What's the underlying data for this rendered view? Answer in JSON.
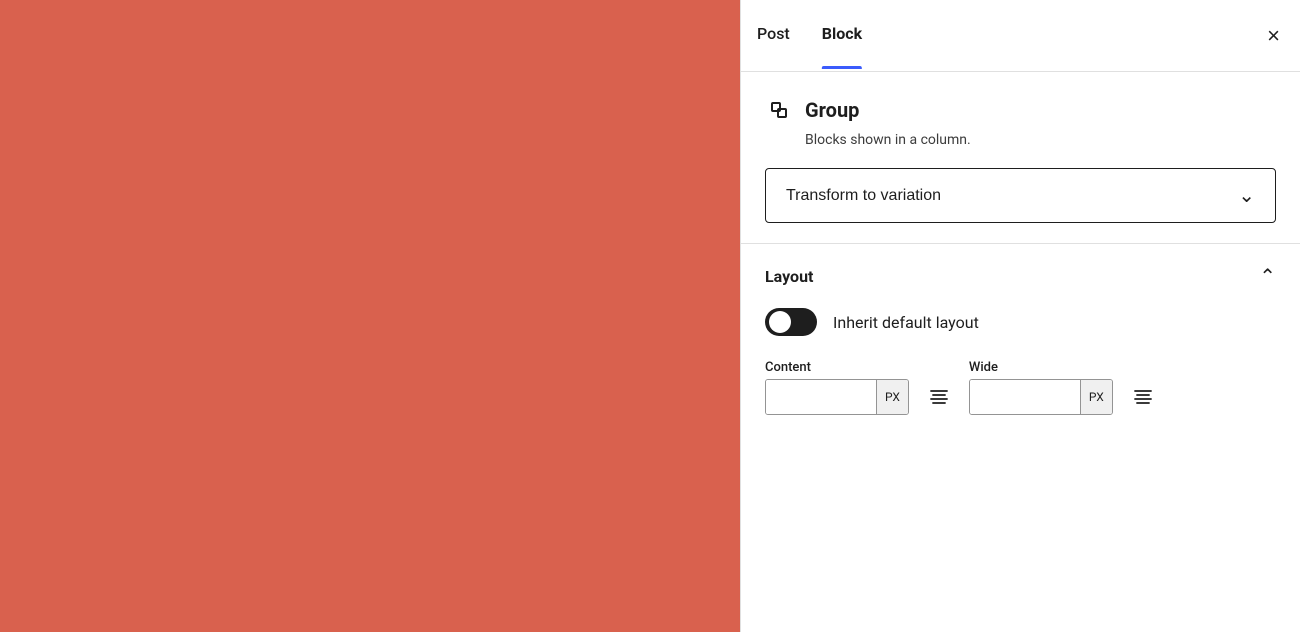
{
  "canvas": {
    "background_color": "#d9614e"
  },
  "sidebar": {
    "tabs": [
      {
        "id": "post",
        "label": "Post",
        "active": false
      },
      {
        "id": "block",
        "label": "Block",
        "active": true
      }
    ],
    "close_label": "×",
    "block_section": {
      "icon_name": "group-icon",
      "title": "Group",
      "description": "Blocks shown in a column.",
      "transform_dropdown": {
        "label": "Transform to variation",
        "chevron": "chevron-down"
      }
    },
    "layout_section": {
      "title": "Layout",
      "chevron": "chevron-up",
      "toggle": {
        "label": "Inherit default layout",
        "checked": true
      },
      "content_field": {
        "label": "Content",
        "value": "",
        "unit": "PX"
      },
      "wide_field": {
        "label": "Wide",
        "value": "",
        "unit": "PX"
      }
    }
  }
}
